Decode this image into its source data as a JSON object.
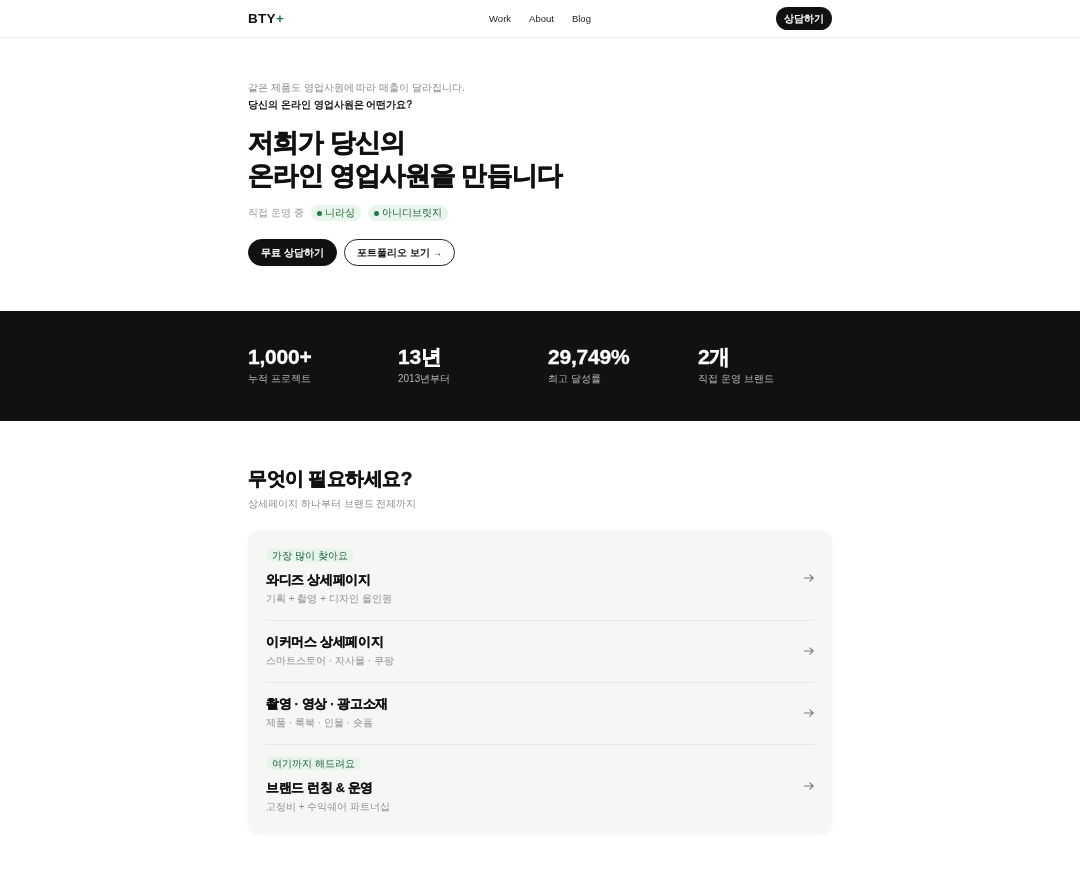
{
  "header": {
    "logo": {
      "text": "BTY",
      "mark": "+"
    },
    "nav": [
      "Work",
      "About",
      "Blog"
    ],
    "cta": "상담하기"
  },
  "hero": {
    "eyebrow": "같은 제품도 영업사원에 따라 매출이 달라집니다.",
    "question": "당신의 온라인 영업사원은 어떤가요?",
    "headline": [
      "저희가 당신의",
      "온라인 영업사원을 만듭니다"
    ],
    "operating_label": "직접 운영 중",
    "brands": [
      "니라싱",
      "아니디브릿지"
    ],
    "buttons": [
      {
        "label": "무료 상담하기",
        "kind": "primary"
      },
      {
        "label": "포트폴리오 보기 →",
        "kind": "outline"
      }
    ]
  },
  "stats": [
    {
      "value": "1,000+",
      "label": "누적 프로젝트"
    },
    {
      "value": "13년",
      "label": "2013년부터"
    },
    {
      "value": "29,749%",
      "label": "최고 달성률"
    },
    {
      "value": "2개",
      "label": "직접 운영 브랜드"
    }
  ],
  "services": {
    "title": "무엇이 필요하세요?",
    "subtitle": "상세페이지 하나부터 브랜드 전체까지",
    "items": [
      {
        "badge": "가장 많이 찾아요",
        "title": "와디즈 상세페이지",
        "subtitle": "기획 + 촬영 + 디자인 올인원"
      },
      {
        "title": "이커머스 상세페이지",
        "subtitle": "스마트스토어 · 자사몰 · 쿠팡"
      },
      {
        "title": "촬영 · 영상 · 광고소재",
        "subtitle": "제품 · 룩북 · 인물 · 숏폼"
      },
      {
        "badge": "여기까지 해드려요",
        "title": "브랜드 런칭 & 운영",
        "subtitle": "고정비 + 수익쉐어 파트너십"
      }
    ]
  }
}
